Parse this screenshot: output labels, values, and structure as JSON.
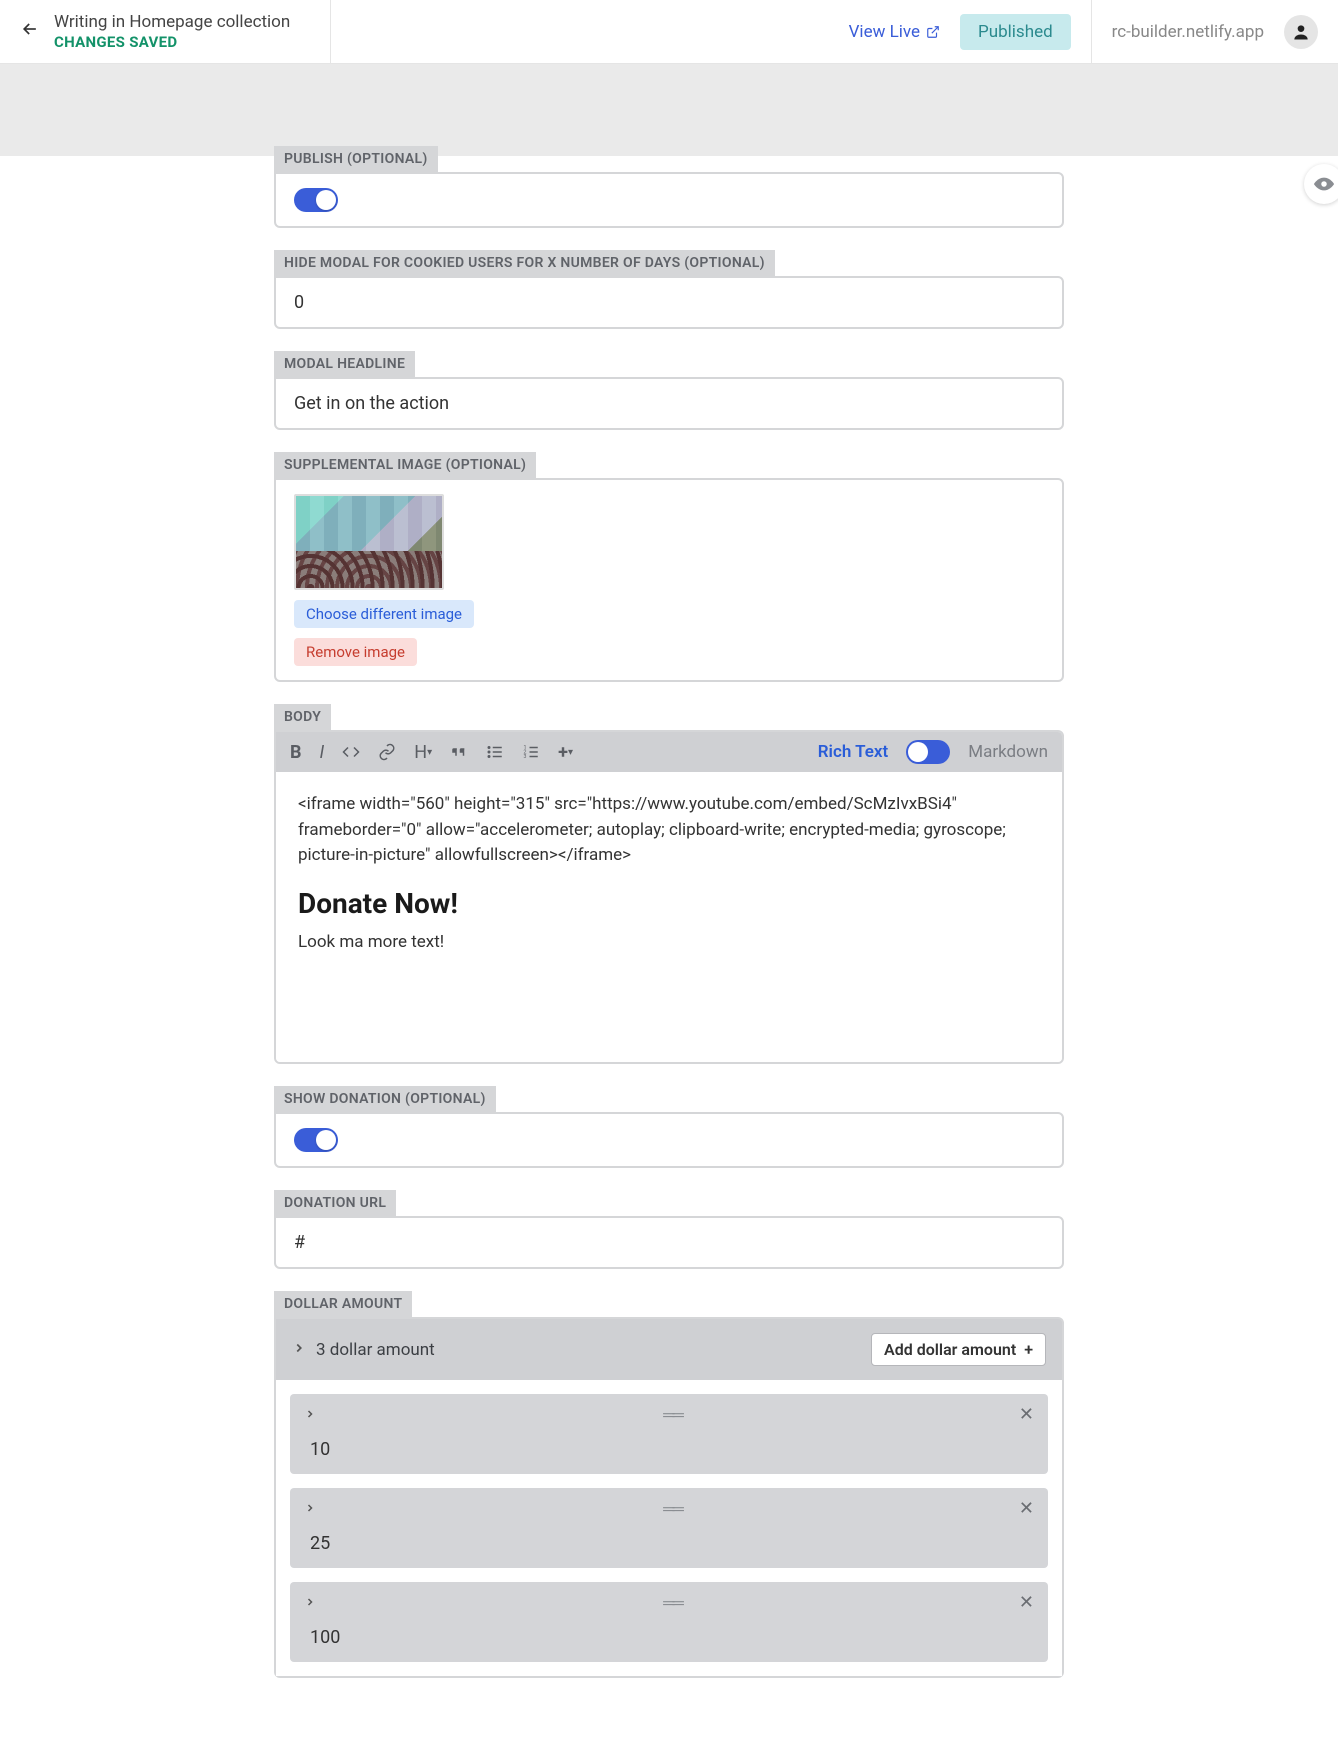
{
  "header": {
    "collection_name": "Writing in Homepage collection",
    "saved_status": "CHANGES SAVED",
    "view_live": "View Live",
    "published": "Published",
    "site_url": "rc-builder.netlify.app"
  },
  "fields": {
    "publish": {
      "label": "PUBLISH (OPTIONAL)",
      "value": true
    },
    "hide_modal": {
      "label": "HIDE MODAL FOR COOKIED USERS FOR X NUMBER OF DAYS (OPTIONAL)",
      "value": "0"
    },
    "modal_headline": {
      "label": "MODAL HEADLINE",
      "value": "Get in on the action"
    },
    "supp_image": {
      "label": "SUPPLEMENTAL IMAGE (OPTIONAL)",
      "choose_label": "Choose different image",
      "remove_label": "Remove image"
    },
    "body": {
      "label": "BODY",
      "rich_text_label": "Rich Text",
      "markdown_label": "Markdown",
      "content_line": "<iframe width=\"560\" height=\"315\" src=\"https://www.youtube.com/embed/ScMzIvxBSi4\" frameborder=\"0\" allow=\"accelerometer; autoplay; clipboard-write; encrypted-media; gyroscope; picture-in-picture\" allowfullscreen></iframe>",
      "heading": "Donate Now!",
      "para": "Look ma more text!"
    },
    "show_donation": {
      "label": "SHOW DONATION (OPTIONAL)",
      "value": true
    },
    "donation_url": {
      "label": "DONATION URL",
      "value": "#"
    },
    "dollar": {
      "label": "DOLLAR AMOUNT",
      "count_text": "3 dollar amount",
      "add_label": "Add dollar amount",
      "amounts": [
        "10",
        "25",
        "100"
      ]
    }
  }
}
